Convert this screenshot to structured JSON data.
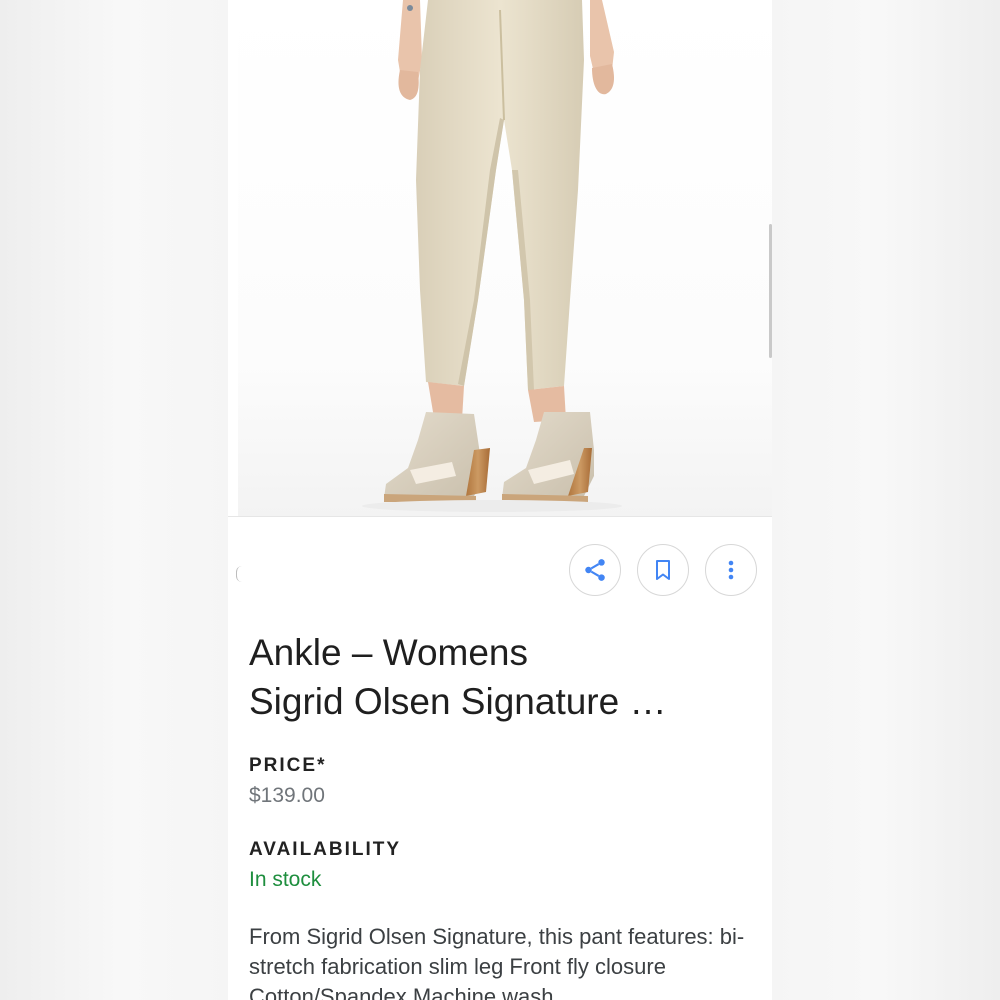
{
  "product": {
    "title_line1": "Ankle – Womens",
    "title_line2": "Sigrid Olsen Signature …",
    "image_alt": "Model wearing beige ankle pants with wedge sandals"
  },
  "actions": {
    "share_icon": "share-icon",
    "bookmark_icon": "bookmark-icon",
    "more_icon": "more-vert-icon",
    "accent_color": "#4285f4"
  },
  "price": {
    "label": "PRICE*",
    "value": "$139.00"
  },
  "availability": {
    "label": "AVAILABILITY",
    "value": "In stock",
    "color": "#1e8e3e"
  },
  "description": {
    "text": "From Sigrid Olsen Signature, this pant features: bi-stretch fabrication slim leg Front fly closure Cotton/Spandex Machine wash"
  }
}
